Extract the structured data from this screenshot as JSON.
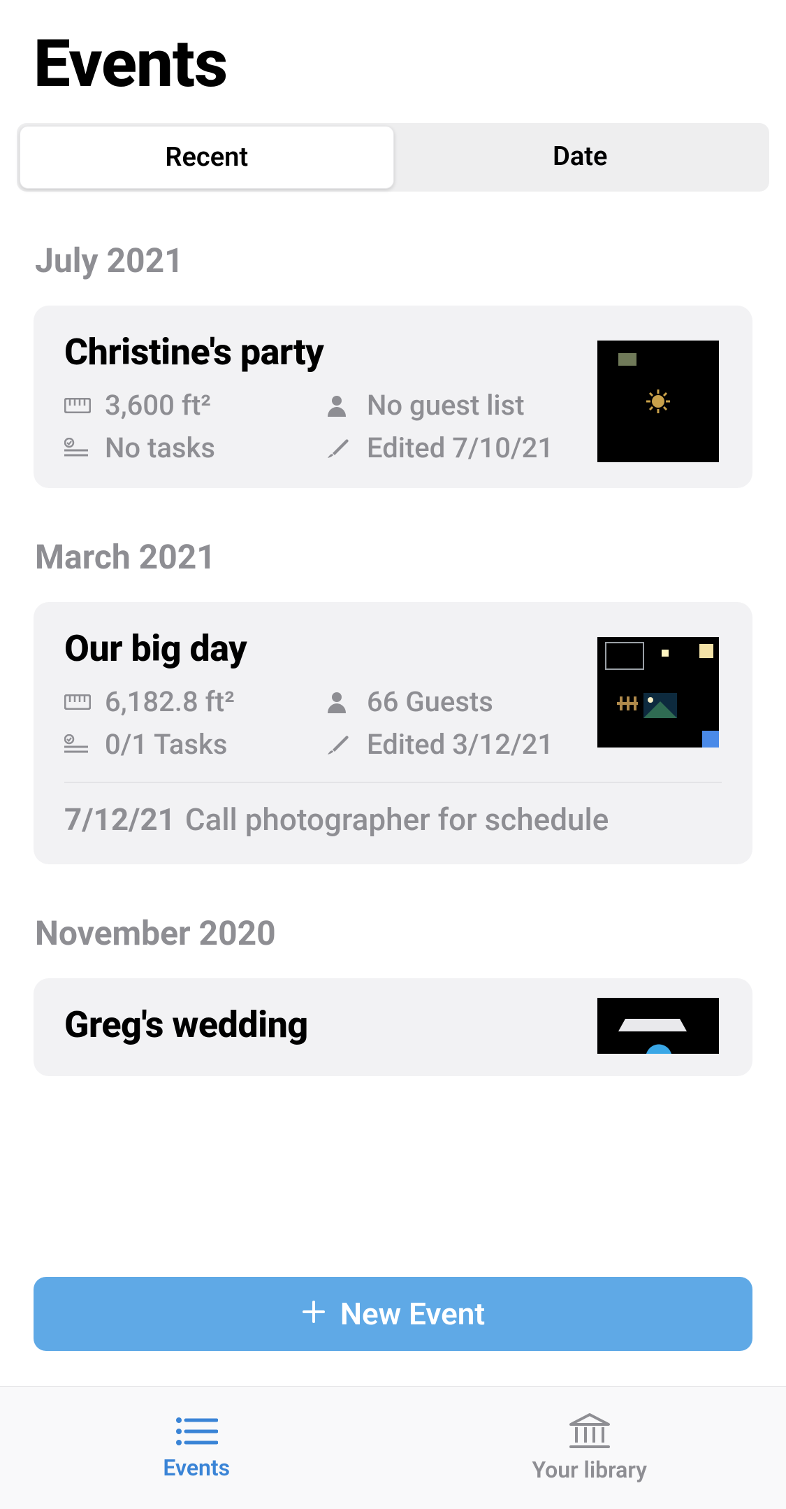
{
  "header": {
    "title": "Events"
  },
  "segmented": {
    "options": [
      "Recent",
      "Date"
    ],
    "active_index": 0
  },
  "sections": [
    {
      "label": "July 2021",
      "events": [
        {
          "title": "Christine's party",
          "area": "3,600 ft²",
          "guests": "No guest list",
          "tasks": "No tasks",
          "edited": "Edited 7/10/21"
        }
      ]
    },
    {
      "label": "March 2021",
      "events": [
        {
          "title": "Our big day",
          "area": "6,182.8 ft²",
          "guests": "66 Guests",
          "tasks": "0/1 Tasks",
          "edited": "Edited 3/12/21",
          "note": {
            "date": "7/12/21",
            "text": "Call photographer for schedule"
          }
        }
      ]
    },
    {
      "label": "November 2020",
      "events": [
        {
          "title": "Greg's wedding"
        }
      ]
    }
  ],
  "new_event_button": "New Event",
  "tabbar": {
    "items": [
      {
        "label": "Events",
        "active": true
      },
      {
        "label": "Your library",
        "active": false
      }
    ]
  }
}
